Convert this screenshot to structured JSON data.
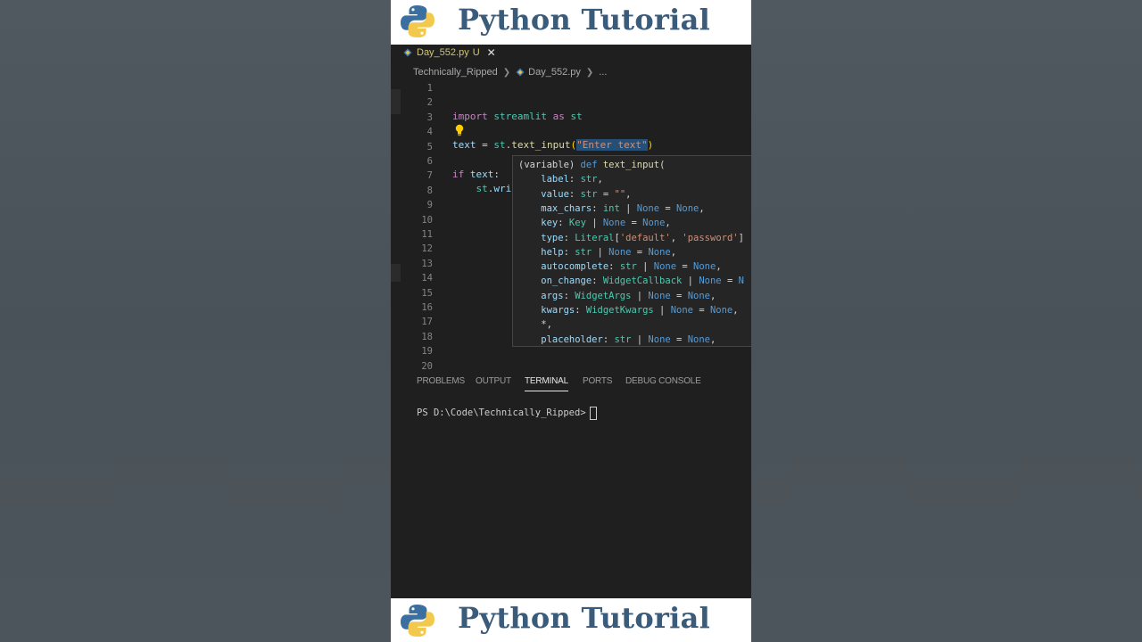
{
  "banner": {
    "title": "Python Tutorial",
    "logo_icon": "python-logo-icon"
  },
  "tab": {
    "filename": "Day_552.py",
    "status": "U",
    "close": "✕"
  },
  "breadcrumb": {
    "folder": "Technically_Ripped",
    "file": "Day_552.py",
    "more": "..."
  },
  "editor": {
    "line_numbers": [
      "1",
      "2",
      "3",
      "4",
      "5",
      "6",
      "7",
      "8",
      "9",
      "10",
      "11",
      "12",
      "13",
      "14",
      "15",
      "16",
      "17",
      "18",
      "19",
      "20"
    ],
    "lines": {
      "l3": {
        "import_kw": "import",
        "module": "streamlit",
        "as_kw": "as",
        "alias": "st"
      },
      "l5": {
        "var": "text",
        "eq": " = ",
        "obj": "st",
        "dot": ".",
        "fn": "text_input",
        "open": "(",
        "arg": "\"Enter text\"",
        "close": ")"
      },
      "l7": {
        "if_kw": "if",
        "cond": "text",
        "colon": ":"
      },
      "l8": {
        "indent": "    ",
        "obj": "st",
        "dot": ".",
        "partial": "wri"
      }
    }
  },
  "hover": {
    "lines": [
      [
        {
          "t": "(variable) ",
          "c": "op"
        },
        {
          "t": "def",
          "c": "kw"
        },
        {
          "t": " ",
          "c": "op"
        },
        {
          "t": "text_input",
          "c": "fn"
        },
        {
          "t": "(",
          "c": "op"
        }
      ],
      [
        {
          "t": "    label",
          "c": "param"
        },
        {
          "t": ": ",
          "c": "op"
        },
        {
          "t": "str",
          "c": "type"
        },
        {
          "t": ",",
          "c": "op"
        }
      ],
      [
        {
          "t": "    value",
          "c": "param"
        },
        {
          "t": ": ",
          "c": "op"
        },
        {
          "t": "str",
          "c": "type"
        },
        {
          "t": " = ",
          "c": "op"
        },
        {
          "t": "\"\"",
          "c": "str"
        },
        {
          "t": ",",
          "c": "op"
        }
      ],
      [
        {
          "t": "    max_chars",
          "c": "param"
        },
        {
          "t": ": ",
          "c": "op"
        },
        {
          "t": "int",
          "c": "type"
        },
        {
          "t": " | ",
          "c": "op"
        },
        {
          "t": "None",
          "c": "none"
        },
        {
          "t": " = ",
          "c": "op"
        },
        {
          "t": "None",
          "c": "none"
        },
        {
          "t": ",",
          "c": "op"
        }
      ],
      [
        {
          "t": "    key",
          "c": "param"
        },
        {
          "t": ": ",
          "c": "op"
        },
        {
          "t": "Key",
          "c": "type"
        },
        {
          "t": " | ",
          "c": "op"
        },
        {
          "t": "None",
          "c": "none"
        },
        {
          "t": " = ",
          "c": "op"
        },
        {
          "t": "None",
          "c": "none"
        },
        {
          "t": ",",
          "c": "op"
        }
      ],
      [
        {
          "t": "    type",
          "c": "param"
        },
        {
          "t": ": ",
          "c": "op"
        },
        {
          "t": "Literal",
          "c": "type"
        },
        {
          "t": "[",
          "c": "op"
        },
        {
          "t": "'default'",
          "c": "str"
        },
        {
          "t": ", ",
          "c": "op"
        },
        {
          "t": "'password'",
          "c": "str"
        },
        {
          "t": "]",
          "c": "op"
        }
      ],
      [
        {
          "t": "    help",
          "c": "param"
        },
        {
          "t": ": ",
          "c": "op"
        },
        {
          "t": "str",
          "c": "type"
        },
        {
          "t": " | ",
          "c": "op"
        },
        {
          "t": "None",
          "c": "none"
        },
        {
          "t": " = ",
          "c": "op"
        },
        {
          "t": "None",
          "c": "none"
        },
        {
          "t": ",",
          "c": "op"
        }
      ],
      [
        {
          "t": "    autocomplete",
          "c": "param"
        },
        {
          "t": ": ",
          "c": "op"
        },
        {
          "t": "str",
          "c": "type"
        },
        {
          "t": " | ",
          "c": "op"
        },
        {
          "t": "None",
          "c": "none"
        },
        {
          "t": " = ",
          "c": "op"
        },
        {
          "t": "None",
          "c": "none"
        },
        {
          "t": ",",
          "c": "op"
        }
      ],
      [
        {
          "t": "    on_change",
          "c": "param"
        },
        {
          "t": ": ",
          "c": "op"
        },
        {
          "t": "WidgetCallback",
          "c": "type"
        },
        {
          "t": " | ",
          "c": "op"
        },
        {
          "t": "None",
          "c": "none"
        },
        {
          "t": " = ",
          "c": "op"
        },
        {
          "t": "N",
          "c": "none"
        }
      ],
      [
        {
          "t": "    args",
          "c": "param"
        },
        {
          "t": ": ",
          "c": "op"
        },
        {
          "t": "WidgetArgs",
          "c": "type"
        },
        {
          "t": " | ",
          "c": "op"
        },
        {
          "t": "None",
          "c": "none"
        },
        {
          "t": " = ",
          "c": "op"
        },
        {
          "t": "None",
          "c": "none"
        },
        {
          "t": ",",
          "c": "op"
        }
      ],
      [
        {
          "t": "    kwargs",
          "c": "param"
        },
        {
          "t": ": ",
          "c": "op"
        },
        {
          "t": "WidgetKwargs",
          "c": "type"
        },
        {
          "t": " | ",
          "c": "op"
        },
        {
          "t": "None",
          "c": "none"
        },
        {
          "t": " = ",
          "c": "op"
        },
        {
          "t": "None",
          "c": "none"
        },
        {
          "t": ",",
          "c": "op"
        }
      ],
      [
        {
          "t": "    *,",
          "c": "op"
        }
      ],
      [
        {
          "t": "    placeholder",
          "c": "param"
        },
        {
          "t": ": ",
          "c": "op"
        },
        {
          "t": "str",
          "c": "type"
        },
        {
          "t": " | ",
          "c": "op"
        },
        {
          "t": "None",
          "c": "none"
        },
        {
          "t": " = ",
          "c": "op"
        },
        {
          "t": "None",
          "c": "none"
        },
        {
          "t": ",",
          "c": "op"
        }
      ]
    ]
  },
  "panel": {
    "tabs": [
      "PROBLEMS",
      "OUTPUT",
      "TERMINAL",
      "PORTS",
      "DEBUG CONSOLE"
    ],
    "active_tab": "TERMINAL",
    "prompt": "PS D:\\Code\\Technically_Ripped>"
  },
  "colors": {
    "banner_title": "#3b5b7b",
    "editor_bg": "#1f1f1f",
    "hover_bg": "#252526"
  }
}
